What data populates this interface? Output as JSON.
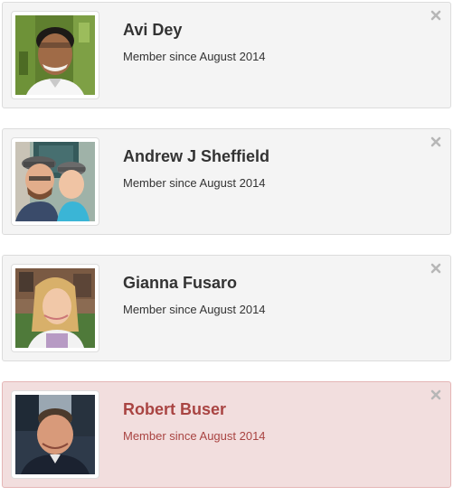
{
  "members": [
    {
      "name": "Avi Dey",
      "meta": "Member since August 2014",
      "highlighted": false,
      "dismiss_icon": "close-icon"
    },
    {
      "name": "Andrew J Sheffield",
      "meta": "Member since August 2014",
      "highlighted": false,
      "dismiss_icon": "close-icon"
    },
    {
      "name": "Gianna Fusaro",
      "meta": "Member since August 2014",
      "highlighted": false,
      "dismiss_icon": "close-icon"
    },
    {
      "name": "Robert Buser",
      "meta": "Member since August 2014",
      "highlighted": true,
      "dismiss_icon": "close-icon"
    }
  ],
  "colors": {
    "card_bg": "#f4f4f4",
    "card_border": "#dcdcdc",
    "highlight_bg": "#f2dede",
    "highlight_text": "#a94442",
    "text": "#333333",
    "close_icon": "#b7b7b7"
  }
}
